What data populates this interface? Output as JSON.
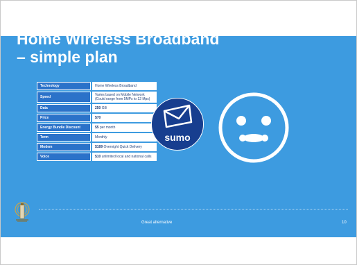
{
  "slide": {
    "title_line1": "Home Wireless Broadband",
    "title_line2": "– simple plan",
    "footer_text": "Great alternative",
    "page_number": "10"
  },
  "plan_table": {
    "rows": [
      {
        "label": "Technology",
        "value_bold": "",
        "value": "Home Wireless Broadband"
      },
      {
        "label": "Speed",
        "value_bold": "",
        "value": "Varies based on Mobile Network",
        "value_line2": "(Could range from 5MPs to 12 Mps)"
      },
      {
        "label": "Data",
        "value_bold": "250",
        "value": " GB"
      },
      {
        "label": "Price",
        "value_bold": "$70",
        "value": ""
      },
      {
        "label": "Energy Bundle Discount",
        "value_bold": "$5",
        "value": " per month"
      },
      {
        "label": "Term",
        "value_bold": "",
        "value": "Monthly"
      },
      {
        "label": "Modem",
        "value_bold": "$189",
        "value": " Overnight Quick Delivery"
      },
      {
        "label": "Voice",
        "value_bold": "$10",
        "value": " unlimited local and national calls"
      }
    ]
  },
  "sumo_badge": {
    "text": "sumo"
  },
  "colors": {
    "slide_bg": "#3d9be0",
    "table_label_bg": "#2b72c9",
    "badge_bg": "#173e8f"
  },
  "icons": {
    "envelope": "envelope-icon",
    "face": "sumo-face-icon",
    "logo": "lighthouse-logo-icon"
  }
}
